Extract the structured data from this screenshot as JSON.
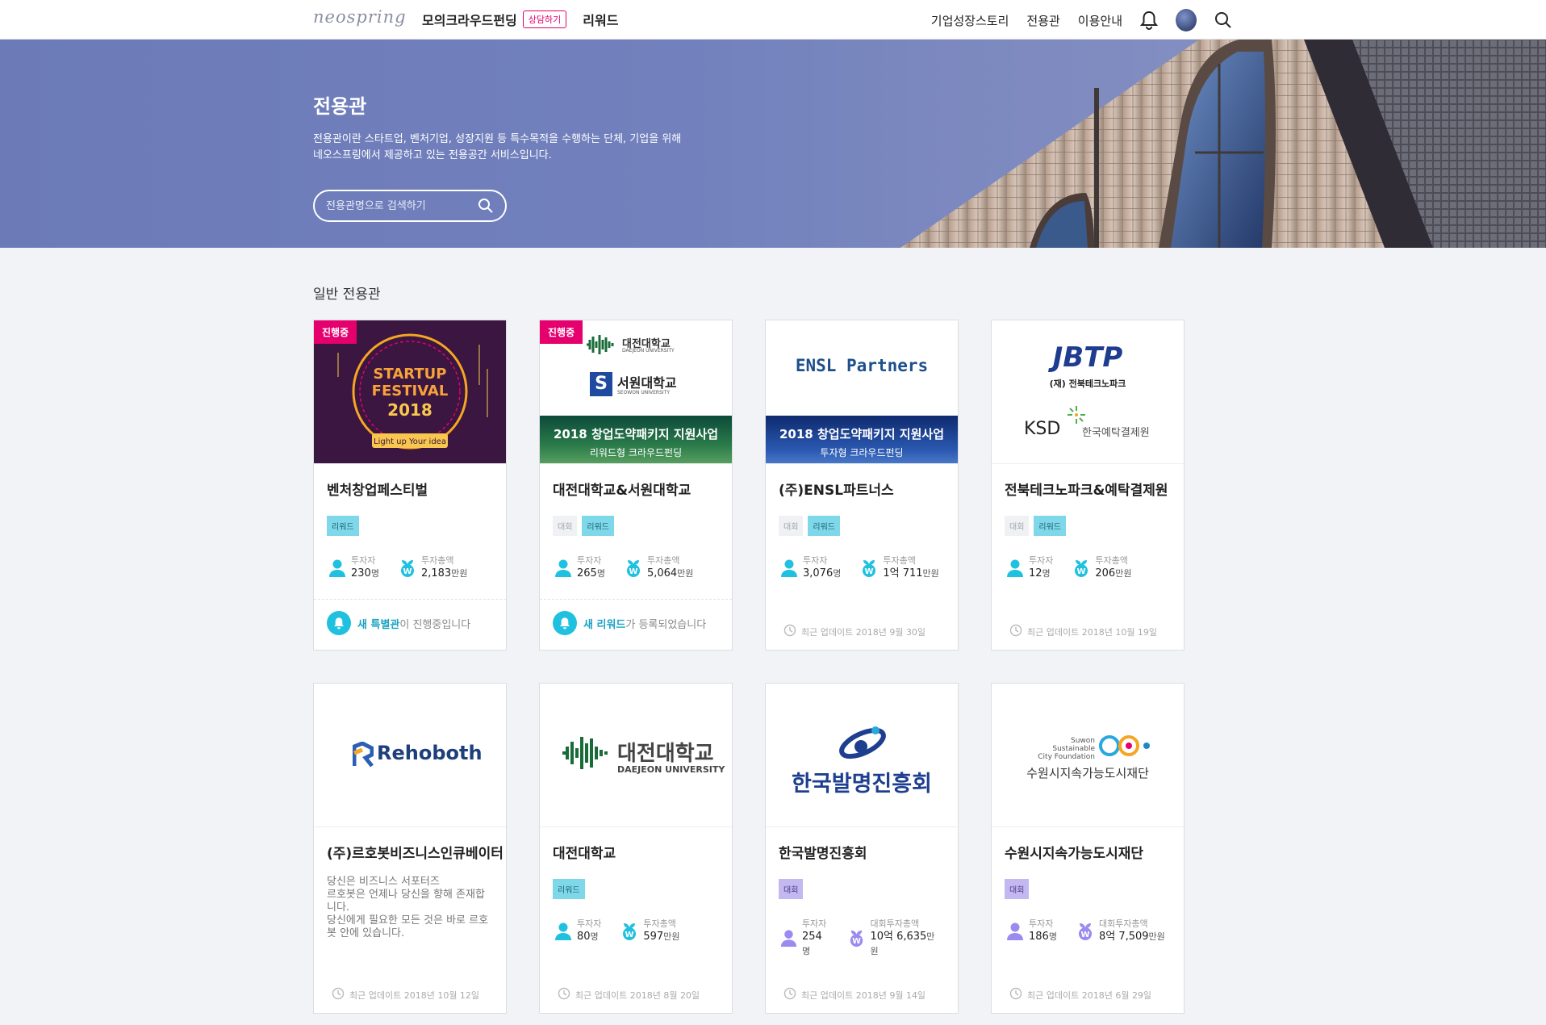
{
  "header": {
    "logo": "neospring",
    "nav_main": [
      "모의크라우드펀딩",
      "리워드"
    ],
    "consult_tag": "상담하기",
    "nav_right": [
      "기업성장스토리",
      "전용관",
      "이용안내"
    ],
    "icons": [
      "bell-icon",
      "avatar",
      "search-icon"
    ]
  },
  "hero": {
    "title": "전용관",
    "desc_line1": "전용관이란 스타트업, 벤처기업, 성장지원 등 특수목적을 수행하는 단체, 기업을 위해",
    "desc_line2": "네오스프링에서 제공하고 있는 전용공간 서비스입니다.",
    "search_placeholder": "전용관명으로 검색하기"
  },
  "section": {
    "title": "일반 전용관"
  },
  "cards": [
    {
      "name": "벤처창업페스티벌",
      "badge": "진행중",
      "thumb": {
        "kind": "festival",
        "t1": "STARTUP",
        "t2": "FESTIVAL",
        "t3": "2018",
        "t4": "Light up Your idea"
      },
      "tags": [
        "리워드"
      ],
      "stat1_label": "투자자",
      "stat1_value": "230",
      "stat1_unit": "명",
      "stat2_label": "투자총액",
      "stat2_value": "2,183",
      "stat2_unit": "만원",
      "notice_bold": "새 특별관",
      "notice_rest": "이 진행중입니다"
    },
    {
      "name": "대전대학교&서원대학교",
      "badge": "진행중",
      "thumb": {
        "kind": "dual",
        "t1": "대전대학교",
        "t1_sub": "DAEJEON UNIVERSITY",
        "t2": "서원대학교",
        "t2_sub": "SEOWON UNIVERSITY",
        "band1": "2018 창업도약패키지 지원사업",
        "band2": "리워드형 크라우드펀딩"
      },
      "tags": [
        "대회",
        "리워드"
      ],
      "stat1_label": "투자자",
      "stat1_value": "265",
      "stat1_unit": "명",
      "stat2_label": "투자총액",
      "stat2_value": "5,064",
      "stat2_unit": "만원",
      "notice_bold": "새 리워드",
      "notice_rest": "가 등록되었습니다"
    },
    {
      "name": "(주)ENSL파트너스",
      "thumb": {
        "kind": "ensl",
        "t1": "ENSL Partners",
        "band1": "2018 창업도약패키지 지원사업",
        "band2": "투자형 크라우드펀딩"
      },
      "tags": [
        "대회",
        "리워드"
      ],
      "stat1_label": "투자자",
      "stat1_value": "3,076",
      "stat1_unit": "명",
      "stat2_label": "투자총액",
      "stat2_value": "1억 711",
      "stat2_unit": "만원",
      "updated": "최근 업데이트 2018년 9월 30일"
    },
    {
      "name": "전북테크노파크&예탁결제원",
      "thumb": {
        "kind": "jbtp",
        "t1": "JBTP",
        "t1_sub": "(재) 전북테크노파크",
        "t2": "KSD",
        "t2_sub": "한국예탁결제원"
      },
      "tags": [
        "대회",
        "리워드"
      ],
      "stat1_label": "투자자",
      "stat1_value": "12",
      "stat1_unit": "명",
      "stat2_label": "투자총액",
      "stat2_value": "206",
      "stat2_unit": "만원",
      "updated": "최근 업데이트 2018년 10월 19일"
    },
    {
      "name": "(주)르호봇비즈니스인큐베이터",
      "thumb": {
        "kind": "rehoboth",
        "t1": "Rehoboth"
      },
      "desc_lines": [
        "당신은 비즈니스 서포터즈",
        "르호봇은 언제나 당신을 향해 존재합",
        "니다.",
        "당신에게 필요한 모든 것은 바로 르호",
        "봇 안에 있습니다."
      ],
      "updated": "최근 업데이트 2018년 10월 12일"
    },
    {
      "name": "대전대학교",
      "thumb": {
        "kind": "daejeon",
        "t1": "대전대학교",
        "t1_sub": "DAEJEON UNIVERSITY"
      },
      "tags": [
        "리워드"
      ],
      "stat1_label": "투자자",
      "stat1_value": "80",
      "stat1_unit": "명",
      "stat2_label": "투자총액",
      "stat2_value": "597",
      "stat2_unit": "만원",
      "updated": "최근 업데이트 2018년 8월 20일"
    },
    {
      "name": "한국발명진흥회",
      "thumb": {
        "kind": "kipa",
        "t1": "한국발명진흥회"
      },
      "tags": [
        "대회"
      ],
      "stat1_label": "투자자",
      "stat1_value": "254",
      "stat1_unit": "명",
      "stat2_label": "대회투자총액",
      "stat2_value": "10억 6,635",
      "stat2_unit": "만원",
      "updated": "최근 업데이트 2018년 9월 14일"
    },
    {
      "name": "수원시지속가능도시재단",
      "thumb": {
        "kind": "suwon",
        "t1": "Suwon",
        "t2": "Sustainable",
        "t3": "City Foundation",
        "t4": "수원시지속가능도시재단"
      },
      "tags": [
        "대회"
      ],
      "stat1_label": "투자자",
      "stat1_value": "186",
      "stat1_unit": "명",
      "stat2_label": "대회투자총액",
      "stat2_value": "8억 7,509",
      "stat2_unit": "만원",
      "updated": "최근 업데이트 2018년 6월 29일"
    }
  ]
}
